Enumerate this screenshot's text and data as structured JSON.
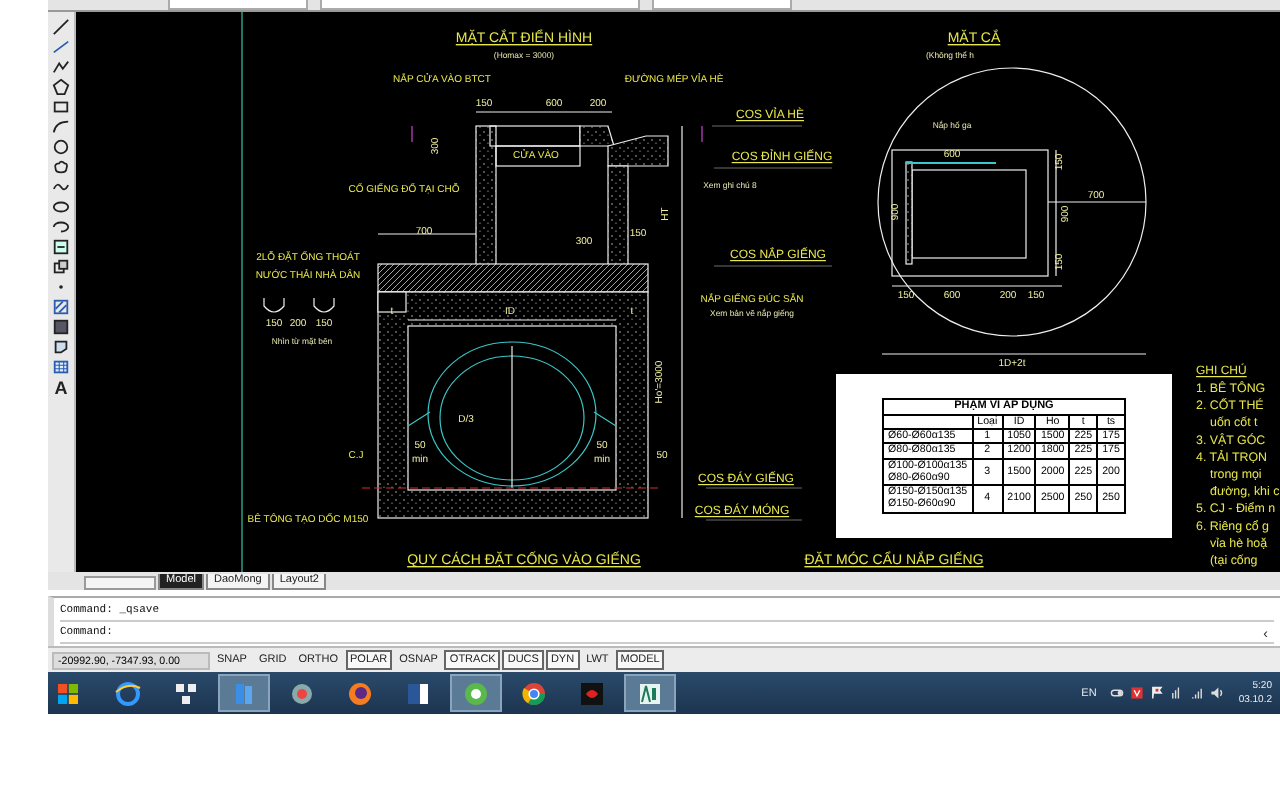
{
  "left_toolbar": {
    "text_tool": "A"
  },
  "drawing": {
    "section_labels": [
      {
        "text": "MẶT CẮT ĐIỂN HÌNH",
        "kind": "title"
      },
      {
        "text": "(Homax = 3000)",
        "kind": "small"
      },
      {
        "text": "NẮP CỬA VÀO BTCT",
        "kind": "label"
      },
      {
        "text": "ĐƯỜNG MÉP VỈA HÈ",
        "kind": "label"
      },
      {
        "text": "150",
        "kind": "dim"
      },
      {
        "text": "600",
        "kind": "dim"
      },
      {
        "text": "200",
        "kind": "dim"
      },
      {
        "text": "COS VỈA HÈ",
        "kind": "cos"
      },
      {
        "text": "300",
        "kind": "dim"
      },
      {
        "text": "CỬA VÀO",
        "kind": "label"
      },
      {
        "text": "COS ĐỈNH GIẾNG",
        "kind": "cos"
      },
      {
        "text": "CỔ GIẾNG ĐỔ TẠI CHỖ",
        "kind": "label"
      },
      {
        "text": "Xem ghi chú 8",
        "kind": "small"
      },
      {
        "text": "HT",
        "kind": "dim"
      },
      {
        "text": "700",
        "kind": "dim"
      },
      {
        "text": "300",
        "kind": "dim"
      },
      {
        "text": "150",
        "kind": "dim"
      },
      {
        "text": "2LỖ ĐẶT ỐNG THOÁT",
        "kind": "label"
      },
      {
        "text": "COS NẮP GIẾNG",
        "kind": "cos"
      },
      {
        "text": "NƯỚC THẢI NHÀ DÂN",
        "kind": "label"
      },
      {
        "text": "NẮP GIẾNG ĐÚC SẴN",
        "kind": "label"
      },
      {
        "text": "Xem bản vẽ nắp giếng",
        "kind": "small"
      },
      {
        "text": "150",
        "kind": "dim"
      },
      {
        "text": "200",
        "kind": "dim"
      },
      {
        "text": "150",
        "kind": "dim"
      },
      {
        "text": "Nhìn từ mặt bên",
        "kind": "small"
      },
      {
        "text": "t",
        "kind": "dim"
      },
      {
        "text": "ID",
        "kind": "dim"
      },
      {
        "text": "t",
        "kind": "dim"
      },
      {
        "text": "Ho'=3000",
        "kind": "dim"
      },
      {
        "text": "D/3",
        "kind": "dim"
      },
      {
        "text": "C.J",
        "kind": "label"
      },
      {
        "text": "50",
        "kind": "dim"
      },
      {
        "text": "min",
        "kind": "dim"
      },
      {
        "text": "50",
        "kind": "dim"
      },
      {
        "text": "min",
        "kind": "dim"
      },
      {
        "text": "50",
        "kind": "dim"
      },
      {
        "text": "COS ĐÁY GIẾNG",
        "kind": "cos"
      },
      {
        "text": "COS ĐÁY MÓNG",
        "kind": "cos"
      },
      {
        "text": "BÊ TÔNG TẠO DỐC M150",
        "kind": "label"
      }
    ],
    "plan_labels": [
      {
        "text": "MẶT CẮ",
        "kind": "title"
      },
      {
        "text": "(Không thể h",
        "kind": "small"
      },
      {
        "text": "Nắp hố ga",
        "kind": "small"
      },
      {
        "text": "600",
        "kind": "dim"
      },
      {
        "text": "150",
        "kind": "dim"
      },
      {
        "text": "900",
        "kind": "dim"
      },
      {
        "text": "150",
        "kind": "dim"
      },
      {
        "text": "700",
        "kind": "dim"
      },
      {
        "text": "900",
        "kind": "dim"
      },
      {
        "text": "150",
        "kind": "dim"
      },
      {
        "text": "600",
        "kind": "dim"
      },
      {
        "text": "200",
        "kind": "dim"
      },
      {
        "text": "150",
        "kind": "dim"
      },
      {
        "text": "1D+2t",
        "kind": "dim"
      }
    ],
    "notes": {
      "heading": "GHI CHÚ",
      "lines": [
        {
          "text": "1.  BÊ TÔNG",
          "kind": "item"
        },
        {
          "text": "2.  CỐT THÉ",
          "kind": "item"
        },
        {
          "text": "uốn cốt t",
          "kind": "cont"
        },
        {
          "text": "3.  VẬT GÓC",
          "kind": "item"
        },
        {
          "text": "4.  TẢI TRỌN",
          "kind": "item"
        },
        {
          "text": "trong mọi",
          "kind": "cont"
        },
        {
          "text": "đường, khi c",
          "kind": "cont"
        },
        {
          "text": "5. CJ - Điểm n",
          "kind": "item"
        },
        {
          "text": "6. Riêng cổ g",
          "kind": "item"
        },
        {
          "text": "vỉa hè hoặ",
          "kind": "cont"
        },
        {
          "text": "(tại cống",
          "kind": "cont"
        }
      ]
    },
    "table": {
      "title": "PHẠM VI ÁP DỤNG",
      "columns": [
        "",
        "Loại",
        "ID",
        "Ho",
        "t",
        "ts"
      ],
      "rows": [
        [
          "Ø60-Ø60α135",
          "1",
          "1050",
          "1500",
          "225",
          "175"
        ],
        [
          "Ø80-Ø80α135",
          "2",
          "1200",
          "1800",
          "225",
          "175"
        ],
        [
          "Ø100-Ø100α135\nØ80-Ø60α90",
          "3",
          "1500",
          "2000",
          "225",
          "200"
        ],
        [
          "Ø150-Ø150α135\nØ150-Ø60α90",
          "4",
          "2100",
          "2500",
          "250",
          "250"
        ]
      ]
    },
    "captions": [
      {
        "text": "QUY CÁCH ĐẶT CỐNG VÀO GIẾNG",
        "kind": "title"
      },
      {
        "text": "ĐẶT MÓC CẨU NẮP GIẾNG",
        "kind": "title"
      }
    ]
  },
  "layout_tabs": [
    {
      "label": "Model",
      "selected": true
    },
    {
      "label": "DaoMong",
      "selected": false
    },
    {
      "label": "Layout2",
      "selected": false
    }
  ],
  "command_lines": [
    "Command:  _qsave",
    "Command:"
  ],
  "command_scroll": "‹",
  "status_bar": {
    "coordinates": "-20992.90, -7347.93, 0.00",
    "toggles": [
      {
        "label": "SNAP",
        "on": false
      },
      {
        "label": "GRID",
        "on": false
      },
      {
        "label": "ORTHO",
        "on": false
      },
      {
        "label": "POLAR",
        "on": true
      },
      {
        "label": "OSNAP",
        "on": false
      },
      {
        "label": "OTRACK",
        "on": true
      },
      {
        "label": "DUCS",
        "on": true
      },
      {
        "label": "DYN",
        "on": true
      },
      {
        "label": "LWT",
        "on": false
      },
      {
        "label": "MODEL",
        "on": true
      }
    ]
  },
  "taskbar": {
    "apps": [
      {
        "kind": "browser-e",
        "selected": false
      },
      {
        "kind": "keyboard",
        "selected": false
      },
      {
        "kind": "files",
        "selected": true
      },
      {
        "kind": "recorder",
        "selected": false
      },
      {
        "kind": "fox",
        "selected": false
      },
      {
        "kind": "word",
        "selected": false
      },
      {
        "kind": "ring",
        "selected": true
      },
      {
        "kind": "chrome",
        "selected": false
      },
      {
        "kind": "game",
        "selected": false
      },
      {
        "kind": "cad",
        "selected": true
      }
    ],
    "language": "EN",
    "time": "5:20",
    "date": "03.10.2"
  }
}
